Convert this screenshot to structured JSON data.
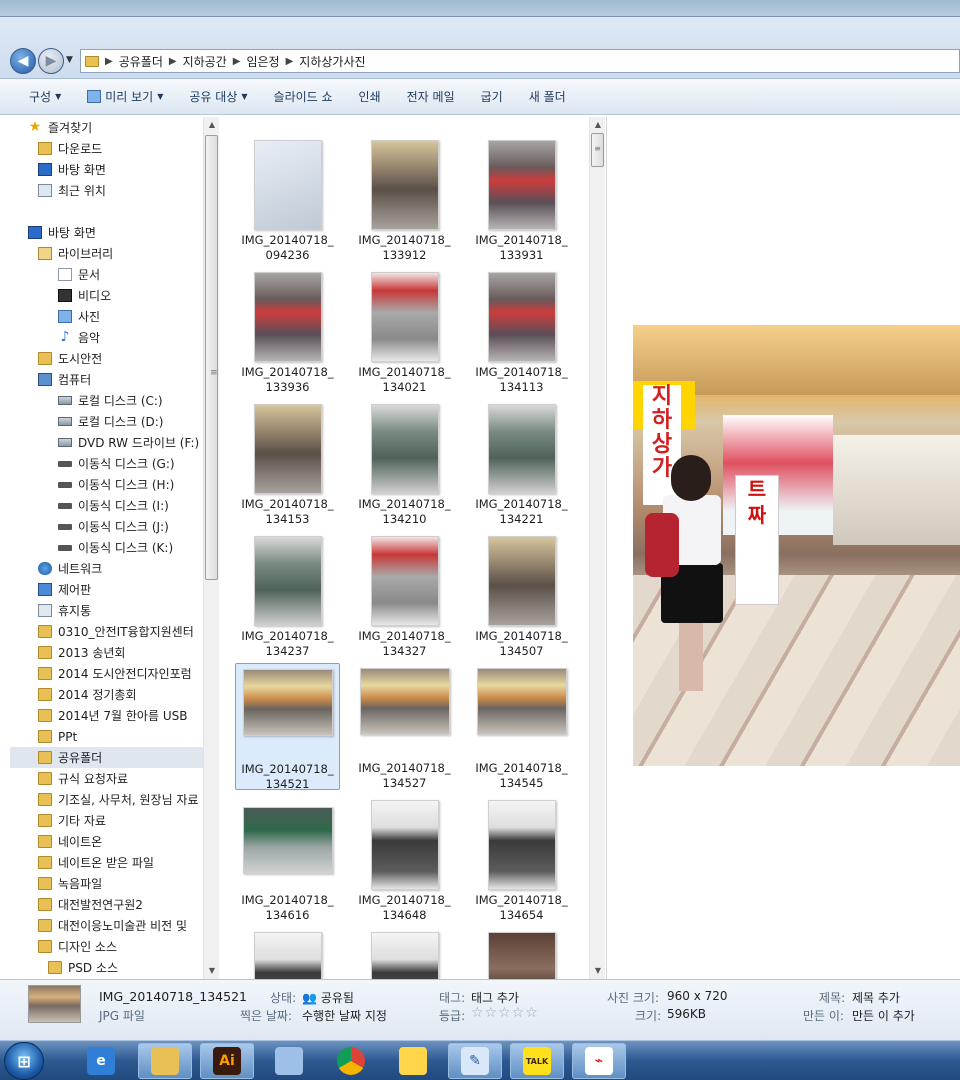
{
  "breadcrumb": [
    "공유폴더",
    "지하공간",
    "임은정",
    "지하상가사진"
  ],
  "toolbar": {
    "organize": "구성",
    "preview": "미리 보기",
    "share": "공유 대상",
    "slideshow": "슬라이드 쇼",
    "print": "인쇄",
    "email": "전자 메일",
    "burn": "굽기",
    "new_folder": "새 폴더"
  },
  "sidebar": {
    "items": [
      {
        "label": "즐겨찾기",
        "icon": "star-icon"
      },
      {
        "label": "다운로드",
        "icon": "downloads-folder-icon"
      },
      {
        "label": "바탕 화면",
        "icon": "desktop-icon"
      },
      {
        "label": "최근 위치",
        "icon": "recent-places-icon"
      },
      {
        "label": "바탕 화면",
        "icon": "desktop-icon"
      },
      {
        "label": "라이브러리",
        "icon": "library-icon"
      },
      {
        "label": "문서",
        "icon": "documents-icon"
      },
      {
        "label": "비디오",
        "icon": "video-icon"
      },
      {
        "label": "사진",
        "icon": "pictures-icon"
      },
      {
        "label": "음악",
        "icon": "music-icon"
      },
      {
        "label": "도시안전",
        "icon": "user-folder-icon"
      },
      {
        "label": "컴퓨터",
        "icon": "computer-icon"
      },
      {
        "label": "로컬 디스크 (C:)",
        "icon": "hard-drive-icon"
      },
      {
        "label": "로컬 디스크 (D:)",
        "icon": "hard-drive-icon"
      },
      {
        "label": "DVD RW 드라이브 (F:)",
        "icon": "dvd-drive-icon"
      },
      {
        "label": "이동식 디스크 (G:)",
        "icon": "removable-disk-icon"
      },
      {
        "label": "이동식 디스크 (H:)",
        "icon": "removable-disk-icon"
      },
      {
        "label": "이동식 디스크 (I:)",
        "icon": "removable-disk-icon"
      },
      {
        "label": "이동식 디스크 (J:)",
        "icon": "removable-disk-icon"
      },
      {
        "label": "이동식 디스크 (K:)",
        "icon": "removable-disk-icon"
      },
      {
        "label": "네트워크",
        "icon": "network-icon"
      },
      {
        "label": "제어판",
        "icon": "control-panel-icon"
      },
      {
        "label": "휴지통",
        "icon": "recycle-bin-icon"
      },
      {
        "label": "0310_안전IT융합지원센터",
        "icon": "folder-icon"
      },
      {
        "label": "2013 송년회",
        "icon": "folder-icon"
      },
      {
        "label": "2014 도시안전디자인포럼",
        "icon": "folder-icon"
      },
      {
        "label": "2014 정기총회",
        "icon": "folder-icon"
      },
      {
        "label": "2014년 7월 한아름 USB",
        "icon": "folder-icon"
      },
      {
        "label": "PPt",
        "icon": "folder-icon"
      },
      {
        "label": "공유폴더",
        "icon": "folder-icon"
      },
      {
        "label": "규식 요청자료",
        "icon": "folder-icon"
      },
      {
        "label": "기조실, 사무처, 원장님 자료",
        "icon": "folder-icon"
      },
      {
        "label": "기타 자료",
        "icon": "folder-icon"
      },
      {
        "label": "네이트온",
        "icon": "folder-icon"
      },
      {
        "label": "네이트온 받은 파일",
        "icon": "folder-icon"
      },
      {
        "label": "녹음파일",
        "icon": "folder-icon"
      },
      {
        "label": "대전발전연구원2",
        "icon": "folder-icon"
      },
      {
        "label": "대전이응노미술관 비전 및",
        "icon": "folder-icon"
      },
      {
        "label": "디자인 소스",
        "icon": "folder-icon"
      },
      {
        "label": "PSD 소스",
        "icon": "folder-icon"
      }
    ]
  },
  "files": [
    {
      "line1": "IMG_20140718_",
      "line2": "094236"
    },
    {
      "line1": "IMG_20140718_",
      "line2": "133912"
    },
    {
      "line1": "IMG_20140718_",
      "line2": "133931"
    },
    {
      "line1": "IMG_20140718_",
      "line2": "133936"
    },
    {
      "line1": "IMG_20140718_",
      "line2": "134021"
    },
    {
      "line1": "IMG_20140718_",
      "line2": "134113"
    },
    {
      "line1": "IMG_20140718_",
      "line2": "134153"
    },
    {
      "line1": "IMG_20140718_",
      "line2": "134210"
    },
    {
      "line1": "IMG_20140718_",
      "line2": "134221"
    },
    {
      "line1": "IMG_20140718_",
      "line2": "134237"
    },
    {
      "line1": "IMG_20140718_",
      "line2": "134327"
    },
    {
      "line1": "IMG_20140718_",
      "line2": "134507"
    },
    {
      "line1": "IMG_20140718_",
      "line2": "134521"
    },
    {
      "line1": "IMG_20140718_",
      "line2": "134527"
    },
    {
      "line1": "IMG_20140718_",
      "line2": "134545"
    },
    {
      "line1": "IMG_20140718_",
      "line2": "134616"
    },
    {
      "line1": "IMG_20140718_",
      "line2": "134648"
    },
    {
      "line1": "IMG_20140718_",
      "line2": "134654"
    },
    {
      "line1": "",
      "line2": ""
    },
    {
      "line1": "",
      "line2": ""
    },
    {
      "line1": "",
      "line2": ""
    }
  ],
  "preview_signs": {
    "vertical": "지하상가",
    "board": [
      "트",
      "짜"
    ]
  },
  "status": {
    "filename": "IMG_20140718_134521",
    "filetype": "JPG 파일",
    "state_label": "상태:",
    "state_value": "공유됨",
    "date_label": "찍은 날짜:",
    "date_value": "수행한 날짜 지정",
    "tags_label": "태그:",
    "tags_value": "태그 추가",
    "rating_label": "등급:",
    "rating_stars": "☆☆☆☆☆",
    "dims_label": "사진 크기:",
    "dims_value": "960 x 720",
    "size_label": "크기:",
    "size_value": "596KB",
    "title_label": "제목:",
    "title_value": "제목 추가",
    "author_label": "만든 이:",
    "author_value": "만든 이 추가"
  },
  "taskbar": {
    "items": [
      {
        "icon": "internet-explorer-icon",
        "glyph": "e"
      },
      {
        "icon": "file-explorer-icon",
        "glyph": ""
      },
      {
        "icon": "illustrator-icon",
        "glyph": "Ai"
      },
      {
        "icon": "feather-app-icon",
        "glyph": ""
      },
      {
        "icon": "chrome-icon",
        "glyph": ""
      },
      {
        "icon": "messenger-smiley-icon",
        "glyph": ""
      },
      {
        "icon": "notepad-app-icon",
        "glyph": "✎"
      },
      {
        "icon": "kakaotalk-icon",
        "glyph": "TALK"
      },
      {
        "icon": "pdf-reader-icon",
        "glyph": "⌁"
      }
    ]
  }
}
